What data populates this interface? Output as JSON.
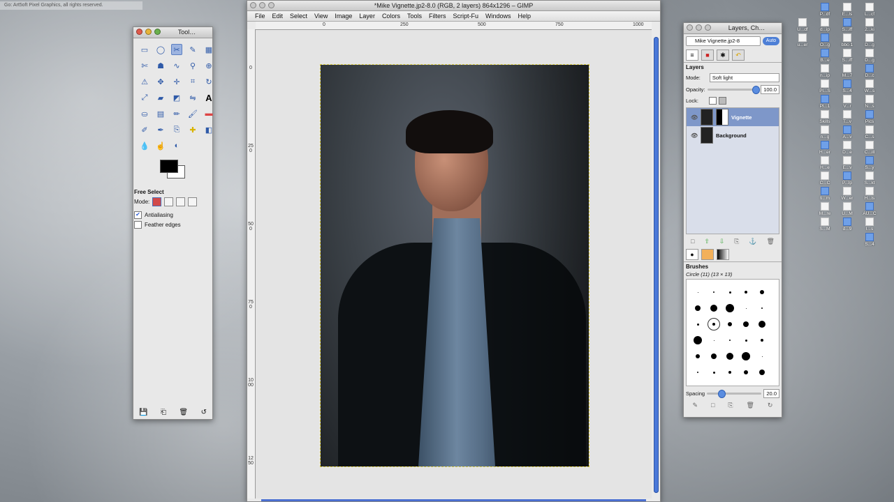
{
  "top_notice": "Go: Art5oft Pixel Graphics, all rights reserved.",
  "toolbox": {
    "title": "Tool…",
    "tool_options_title": "Free Select",
    "mode_label": "Mode:",
    "antialiasing_label": "Antialiasing",
    "antialiasing_checked": true,
    "feather_label": "Feather edges",
    "feather_checked": false
  },
  "image_window": {
    "title": "*Mike Vignette.jp2-8.0 (RGB, 2 layers) 864x1296 – GIMP",
    "menus": [
      "File",
      "Edit",
      "Select",
      "View",
      "Image",
      "Layer",
      "Colors",
      "Tools",
      "Filters",
      "Script-Fu",
      "Windows",
      "Help"
    ],
    "ruler_h": [
      "0",
      "250",
      "500",
      "750",
      "1000"
    ],
    "ruler_v": [
      "0",
      "250",
      "500",
      "750",
      "1000",
      "1250"
    ]
  },
  "layers_dock": {
    "title": "Layers, Ch…",
    "image_select": "Mike Vignette.jp2-8",
    "auto_label": "Auto",
    "panel_title": "Layers",
    "mode_label": "Mode:",
    "mode_value": "Soft light",
    "opacity_label": "Opacity:",
    "opacity_value": "100.0",
    "opacity": 1.0,
    "lock_label": "Lock:",
    "layers": [
      {
        "name": "Vignette",
        "selected": true
      },
      {
        "name": "Background",
        "selected": false
      }
    ],
    "brushes_title": "Brushes",
    "brush_name": "Circle (11) (13 × 13)",
    "spacing_label": "Spacing",
    "spacing_value": "20.0",
    "spacing": 0.2
  },
  "desktop_icons": [
    [
      "P...df",
      "E...ls",
      "L...cf"
    ],
    [
      "U...df",
      "d...ip",
      "S...iff",
      "2...ki"
    ],
    [
      "u...er",
      "O...g",
      "bbc-1",
      "D...g"
    ],
    [
      "B...e",
      "S...iff",
      "D...g"
    ],
    [
      "n...ip",
      "M...7",
      "D...c"
    ],
    [
      "Pl...S",
      "S...4",
      "W...s"
    ],
    [
      "Pl...1",
      "V...r",
      "N...s"
    ],
    [
      "Skills",
      "T...v",
      "Pics"
    ],
    [
      "n...g",
      "A...v",
      "C...s"
    ],
    [
      "H...er",
      "D...e",
      "C...ill"
    ],
    [
      "H...e",
      "E...v",
      "S...y"
    ],
    [
      "C...C",
      "P...lp",
      "S...kt"
    ],
    [
      "ti...m",
      "W...er",
      "H...ls"
    ],
    [
      "M...re",
      "U...M",
      "AU...C"
    ],
    [
      "S...M",
      "d...9",
      "I...s"
    ],
    [
      "S...4"
    ]
  ]
}
